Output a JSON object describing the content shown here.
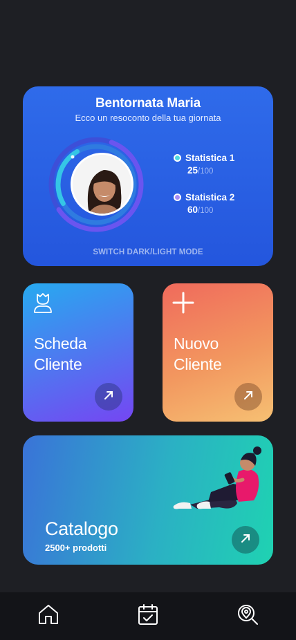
{
  "welcome": {
    "title": "Bentornata Maria",
    "subtitle": "Ecco un resoconto della tua giornata",
    "stats": [
      {
        "label": "Statistica 1",
        "value": "25",
        "max": "/100",
        "progress": 0.25,
        "color": "#4fd9e0"
      },
      {
        "label": "Statistica 2",
        "value": "60",
        "max": "/100",
        "progress": 0.6,
        "color": "#a78cf5"
      }
    ],
    "switch_mode": "SWITCH DARK/LIGHT MODE"
  },
  "tiles": {
    "scheda": {
      "line1": "Scheda",
      "line2": "Cliente",
      "icon": "user-icon"
    },
    "nuovo": {
      "line1": "Nuovo",
      "line2": "Cliente",
      "icon": "plus-icon"
    }
  },
  "catalogo": {
    "title": "Catalogo",
    "subtitle": "2500+ prodotti",
    "icon": "arrow-up-right-icon"
  },
  "nav": {
    "items": [
      {
        "name": "home",
        "icon": "home-icon"
      },
      {
        "name": "calendar",
        "icon": "calendar-check-icon"
      },
      {
        "name": "location-search",
        "icon": "location-search-icon"
      }
    ]
  },
  "colors": {
    "background": "#1e1f24",
    "welcome_card": "#2b62e6",
    "nav_bar": "#131418"
  }
}
